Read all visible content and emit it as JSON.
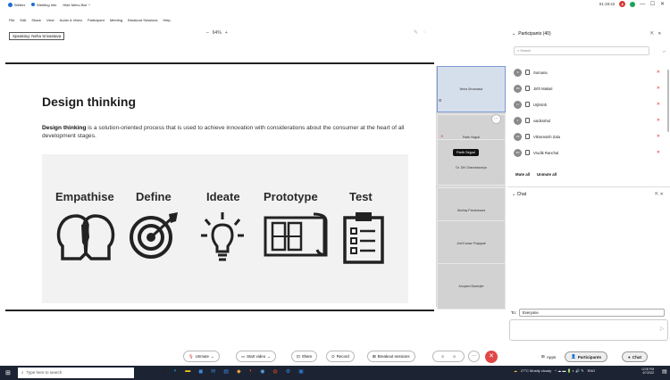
{
  "titlebar": {
    "app_name": "Webex",
    "meeting_info": "Meeting Info",
    "hide_menu": "Hide Menu Bar",
    "timer": "01:19:22",
    "window_controls": "— ☐ ✕"
  },
  "menu": [
    "File",
    "Edit",
    "Share",
    "View",
    "Audio & Video",
    "Participant",
    "Meeting",
    "Breakout Sessions",
    "Help"
  ],
  "stage": {
    "speaking": "Speaking: Neha Srivastava",
    "zoom": "64%",
    "zoom_minus": "–",
    "zoom_plus": "+"
  },
  "slide": {
    "title": "Design thinking",
    "body_bold": "Design thinking",
    "body_rest": " is a solution-oriented process that is used to achieve innovation with considerations about the consumer at the heart of all development stages.",
    "stages": [
      "Empathise",
      "Define",
      "Ideate",
      "Prototype",
      "Test"
    ]
  },
  "video_tiles": [
    "Neha Srivastava",
    "Parth Sejpal",
    "Dr. Dhl Chandrasuriya",
    "Akshay Panchasara",
    "Anil Kumar Prajapati",
    "Anupam Banerjee"
  ],
  "tooltip": "Parth Sejpal",
  "participants": {
    "header": "Participants (40)",
    "search_placeholder": "Search",
    "list": [
      {
        "name": "Sumana",
        "initials": "S"
      },
      {
        "name": "Jirth Makati",
        "initials": "JM"
      },
      {
        "name": "Urjitsinh",
        "initials": "U"
      },
      {
        "name": "vaidsrahul",
        "initials": "V"
      },
      {
        "name": "Vikramsinh Zala",
        "initials": "VZ"
      },
      {
        "name": "Vrudik Ranchal",
        "initials": "VR"
      }
    ],
    "mute_all": "Mute all",
    "unmute_all": "Unmute all"
  },
  "chat": {
    "header": "Chat",
    "to_label": "To:",
    "to_value": "Everyone"
  },
  "toolbar": {
    "unmute": "Unmute",
    "start_video": "Start video",
    "share": "Share",
    "record": "Record",
    "breakout": "Breakout sessions",
    "apps": "Apps",
    "participants": "Participants",
    "chat": "Chat"
  },
  "taskbar": {
    "search_placeholder": "Type here to search",
    "weather": "27°C Mostly cloudy",
    "lang": "ENG",
    "time": "12:00 PM",
    "date": "4/7/2022"
  },
  "colors": {
    "accent_blue": "#1d6cd6",
    "leave_red": "#e04848",
    "muted_red": "#d33333",
    "taskbar": "#1c2333"
  }
}
